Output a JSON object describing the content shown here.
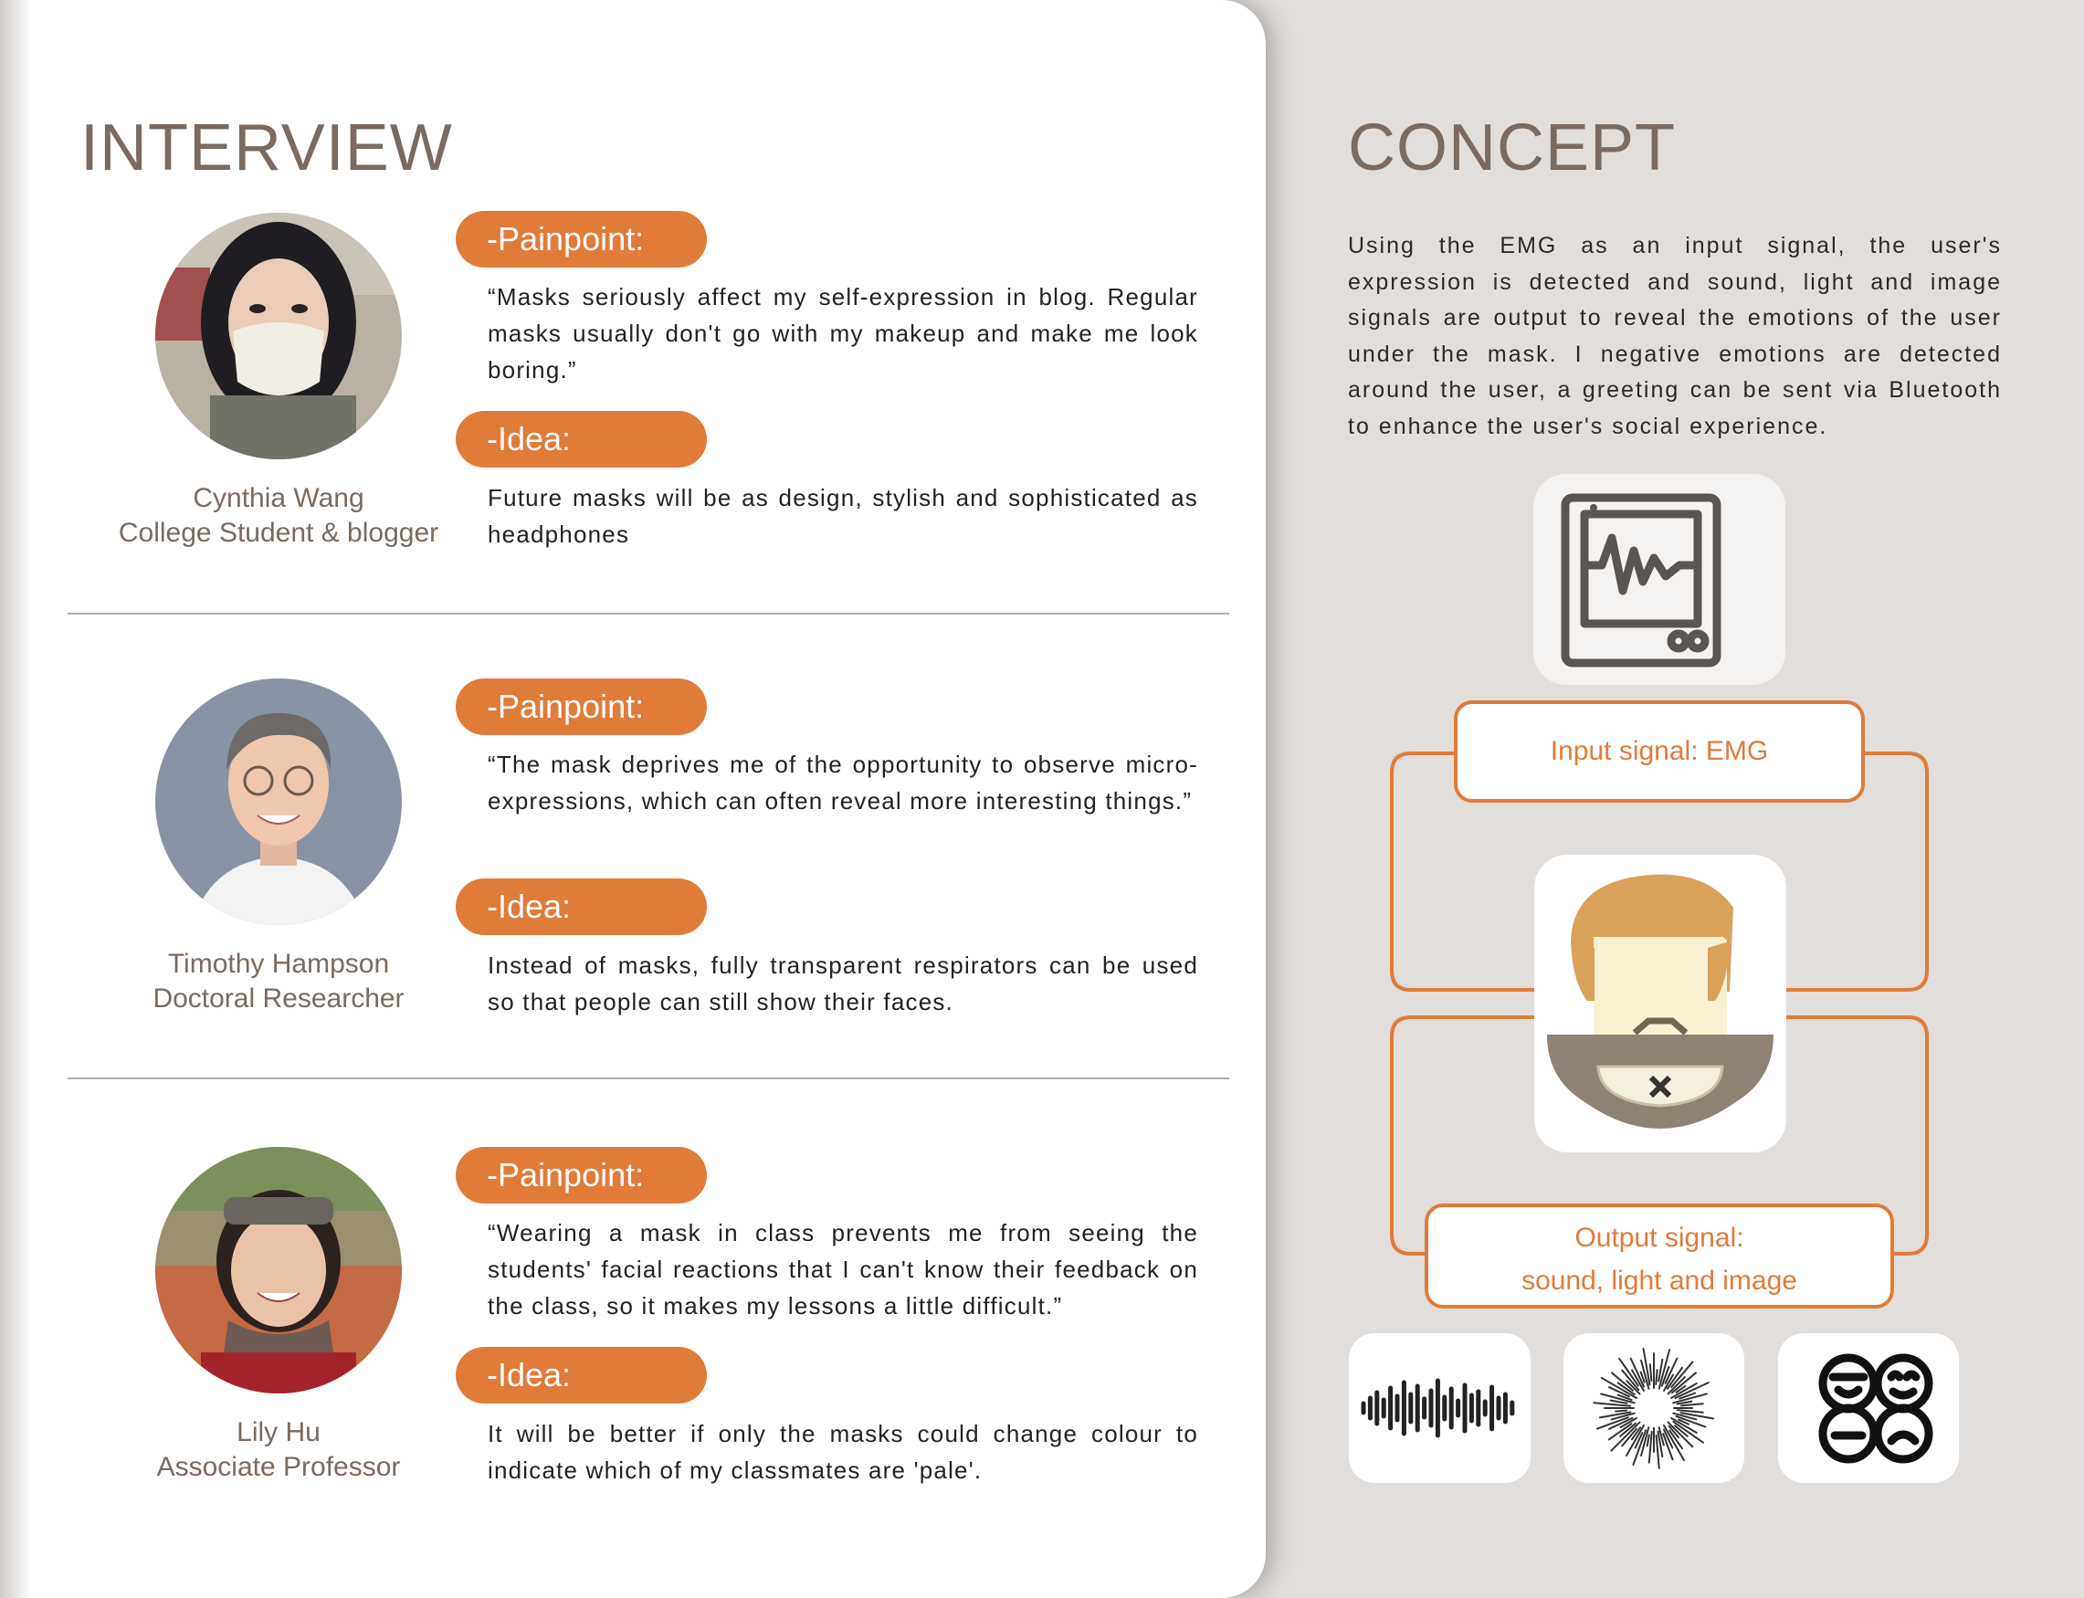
{
  "interview": {
    "title": "INTERVIEW",
    "people": [
      {
        "name": "Cynthia Wang",
        "role": "College Student & blogger",
        "painpoint_label": "-Painpoint:",
        "painpoint": "“Masks seriously affect my self-expression in blog. Regular masks usually don't go with my makeup and make me look boring.”",
        "idea_label": "-Idea:",
        "idea": "Future masks will be as design, stylish and sophisticated as headphones"
      },
      {
        "name": "Timothy Hampson",
        "role": "Doctoral Researcher",
        "painpoint_label": "-Painpoint:",
        "painpoint": "“The mask deprives me of the opportunity to observe micro-expressions, which can often reveal more interesting things.”",
        "idea_label": "-Idea:",
        "idea": "Instead of masks, fully transparent respirators can be used so that people can still show their faces."
      },
      {
        "name": "Lily Hu",
        "role": "Associate Professor",
        "painpoint_label": "-Painpoint:",
        "painpoint": "“Wearing a mask in class prevents me from seeing the students' facial reactions that I can't know their feedback on the class, so it makes my lessons a little difficult.”",
        "idea_label": "-Idea:",
        "idea": "It will be better if only the masks could change colour to indicate which of my classmates are 'pale'."
      }
    ]
  },
  "concept": {
    "title": "CONCEPT",
    "description": "Using the EMG as an input signal, the user's expression is detected and sound, light and image signals are output to reveal the emotions of the user under the mask. I negative emotions are detected around the user, a greeting can be sent via Bluetooth to enhance the user's social experience.",
    "input_signal": "Input signal: EMG",
    "output_signal_line1": "Output signal:",
    "output_signal_line2": "sound, light and image",
    "icons": [
      "monitor-waveform-icon",
      "masked-face-icon",
      "sound-wave-icon",
      "light-burst-icon",
      "emoji-faces-icon"
    ]
  },
  "colors": {
    "accent": "#e07b3a",
    "heading": "#7b6a60",
    "background": "#e2dedb",
    "panel": "#ffffff"
  }
}
